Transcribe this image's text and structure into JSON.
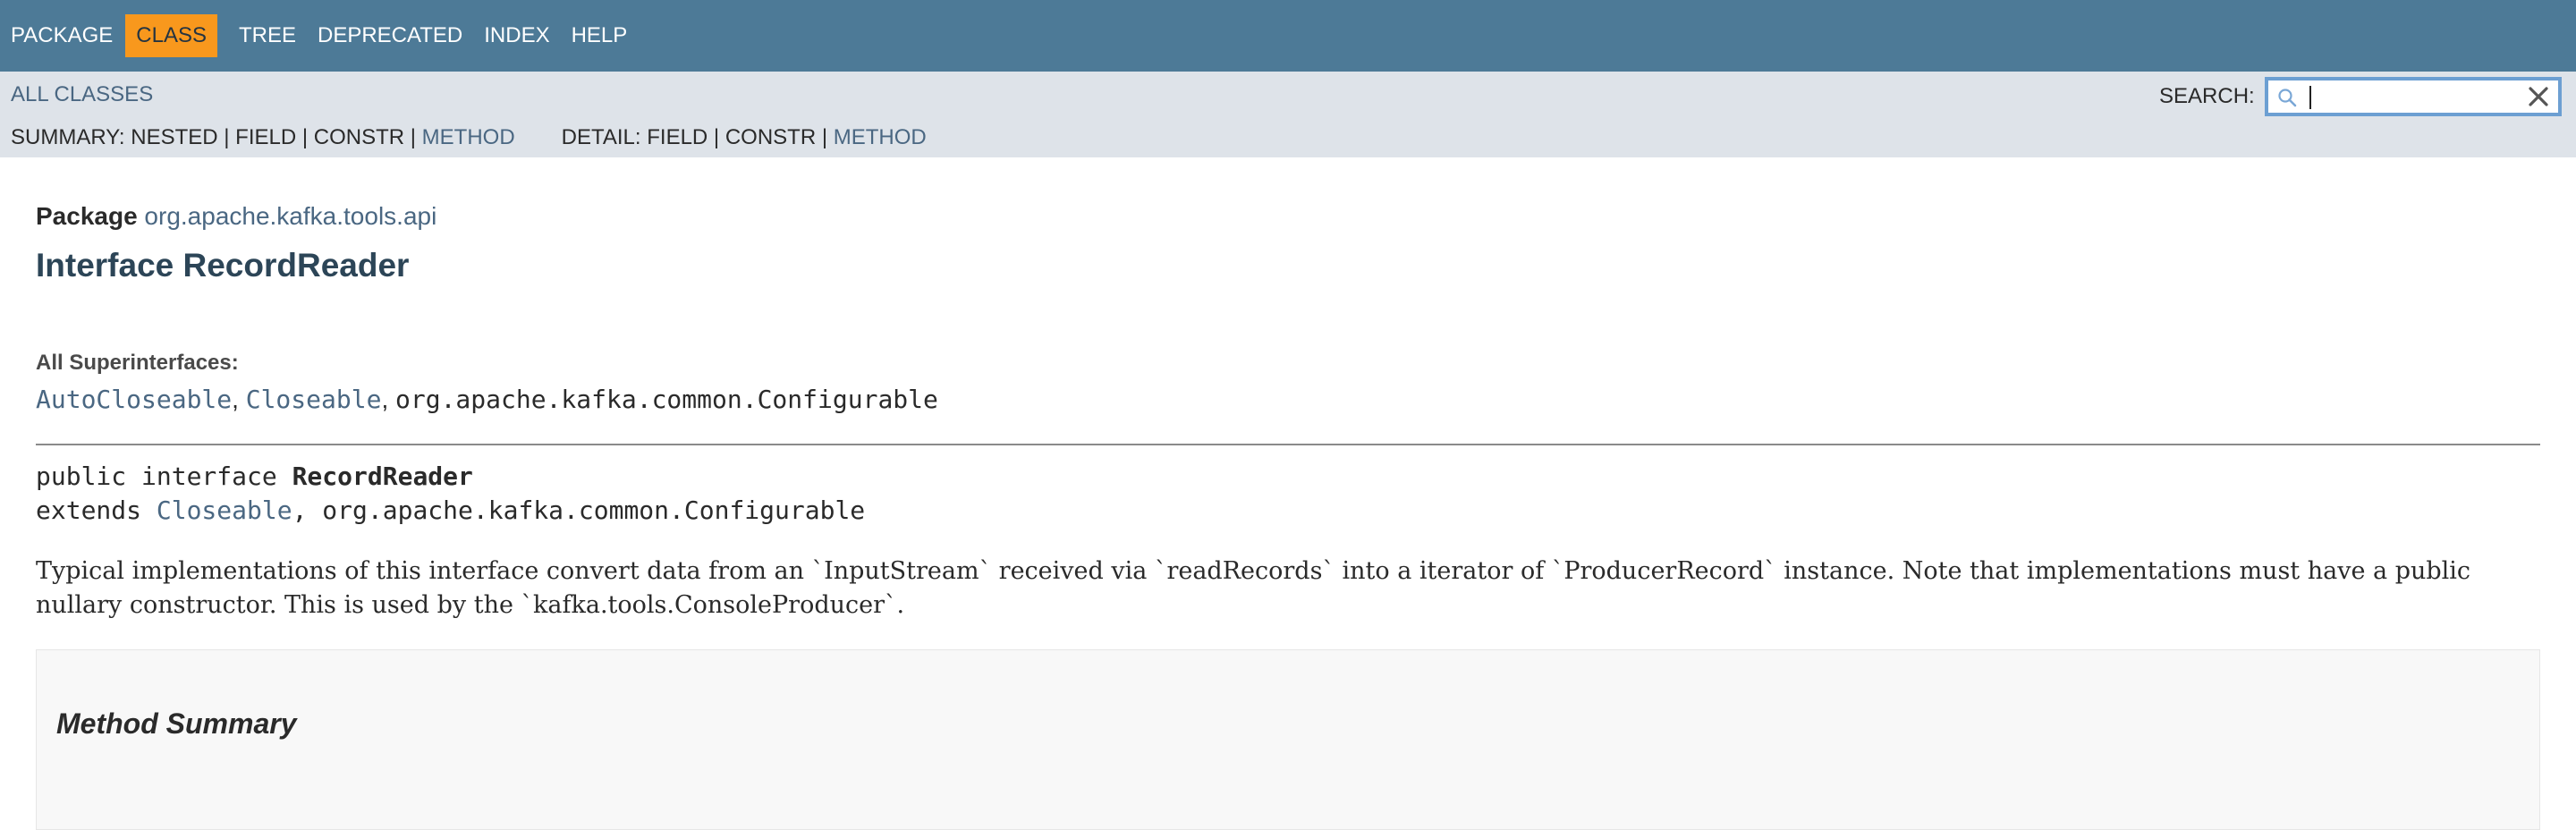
{
  "topnav": {
    "items": [
      {
        "label": "PACKAGE",
        "active": false
      },
      {
        "label": "CLASS",
        "active": true
      },
      {
        "label": "TREE",
        "active": false
      },
      {
        "label": "DEPRECATED",
        "active": false
      },
      {
        "label": "INDEX",
        "active": false
      },
      {
        "label": "HELP",
        "active": false
      }
    ]
  },
  "subnav": {
    "all_classes": "ALL CLASSES",
    "summary_prefix": "SUMMARY: NESTED | FIELD | CONSTR | ",
    "summary_method": "METHOD",
    "detail_prefix": "DETAIL: FIELD | CONSTR | ",
    "detail_method": "METHOD"
  },
  "search": {
    "label": "SEARCH:",
    "value": "",
    "placeholder": ""
  },
  "package": {
    "label": "Package",
    "name": "org.apache.kafka.tools.api"
  },
  "title": "Interface RecordReader",
  "superinterfaces": {
    "label": "All Superinterfaces:",
    "items": [
      {
        "text": "AutoCloseable",
        "link": true
      },
      {
        "text": "Closeable",
        "link": true
      },
      {
        "text": "org.apache.kafka.common.Configurable",
        "link": false
      }
    ]
  },
  "declaration": {
    "prefix": "public interface ",
    "name": "RecordReader",
    "extends_keyword": "extends ",
    "extends_link": "Closeable",
    "extends_rest": ", org.apache.kafka.common.Configurable"
  },
  "description": "Typical implementations of this interface convert data from an `InputStream` received via `readRecords` into a iterator of `ProducerRecord` instance. Note that implementations must have a public nullary constructor. This is used by the `kafka.tools.ConsoleProducer`.",
  "method_summary": {
    "heading": "Method Summary"
  },
  "colors": {
    "topnav_bg": "#4d7a97",
    "active_tab": "#f8981d",
    "subnav_bg": "#dee3e9",
    "link": "#4a6782"
  }
}
